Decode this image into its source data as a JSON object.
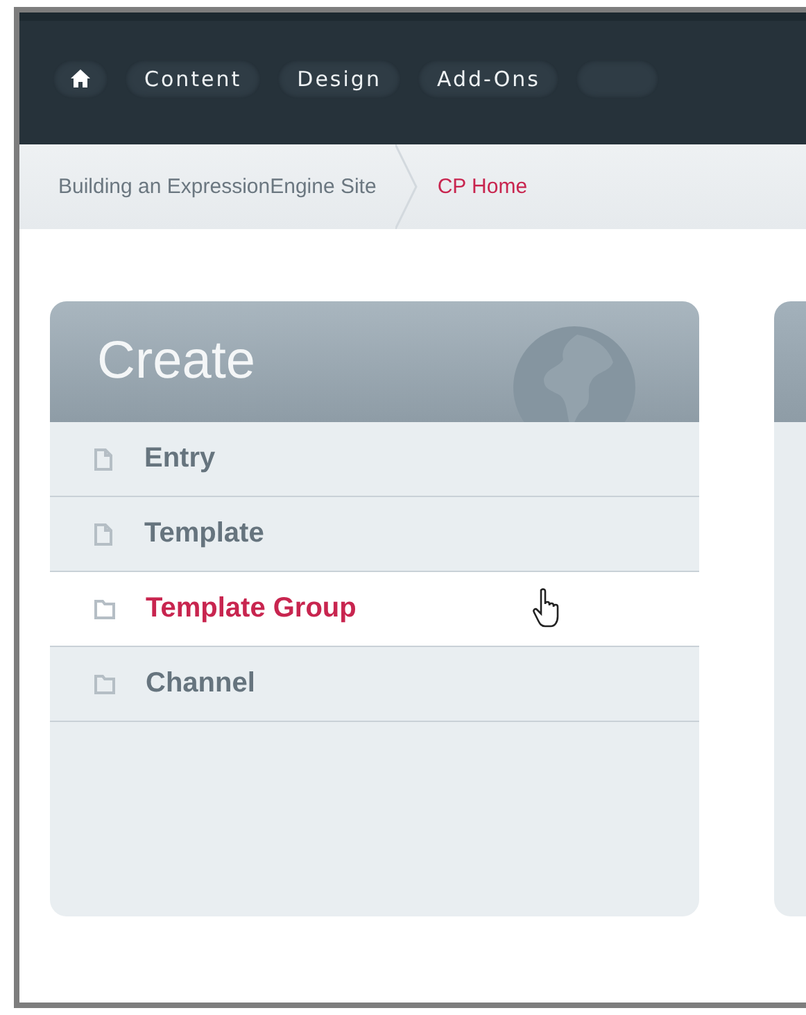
{
  "nav": {
    "home_selected": false,
    "items": [
      {
        "label": "Content"
      },
      {
        "label": "Design"
      },
      {
        "label": "Add-Ons"
      }
    ]
  },
  "breadcrumb": [
    {
      "label": "Building an ExpressionEngine Site",
      "current": false
    },
    {
      "label": "CP Home",
      "current": true
    }
  ],
  "panel": {
    "title": "Create",
    "items": [
      {
        "label": "Entry",
        "kind": "file",
        "hovered": false
      },
      {
        "label": "Template",
        "kind": "file",
        "hovered": false
      },
      {
        "label": "Template Group",
        "kind": "folder",
        "hovered": true
      },
      {
        "label": "Channel",
        "kind": "folder",
        "hovered": false
      }
    ]
  }
}
